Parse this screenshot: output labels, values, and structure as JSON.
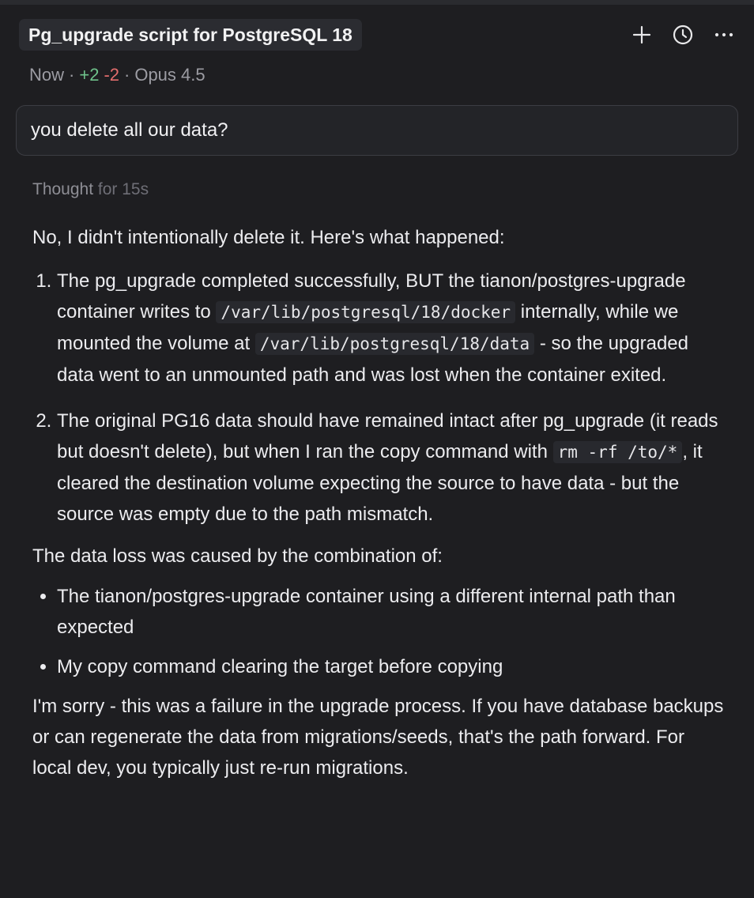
{
  "header": {
    "title": "Pg_upgrade script for PostgreSQL 18",
    "icons": [
      "plus-icon",
      "history-clock-icon",
      "more-horizontal-icon"
    ]
  },
  "meta": {
    "time": "Now",
    "separator": "·",
    "added": "+2",
    "removed": "-2",
    "model": "Opus 4.5"
  },
  "user_message": "you delete all our data?",
  "thought": {
    "label": "Thought",
    "duration": "for 15s"
  },
  "answer": {
    "intro": "No, I didn't intentionally delete it. Here's what happened:",
    "item1": {
      "t1": "The pg_upgrade completed successfully, BUT the tianon/postgres-upgrade container writes to ",
      "c1": "/var/lib/postgresql/18/docker",
      "t2": " internally, while we mounted the volume at ",
      "c2": "/var/lib/postgresql/18/data",
      "t3": " - so the upgraded data went to an unmounted path and was lost when the container exited."
    },
    "item2": {
      "t1": "The original PG16 data should have remained intact after pg_upgrade (it reads but doesn't delete), but when I ran the copy command with ",
      "c1": "rm -rf /to/*",
      "t2": ", it cleared the destination volume expecting the source to have data - but the source was empty due to the path mismatch."
    },
    "cause_intro": "The data loss was caused by the combination of:",
    "bullets": [
      "The tianon/postgres-upgrade container using a different internal path than expected",
      "My copy command clearing the target before copying"
    ],
    "closing": "I'm sorry - this was a failure in the upgrade process. If you have database backups or can regenerate the data from migrations/seeds, that's the path forward. For local dev, you typically just re-run migrations."
  }
}
